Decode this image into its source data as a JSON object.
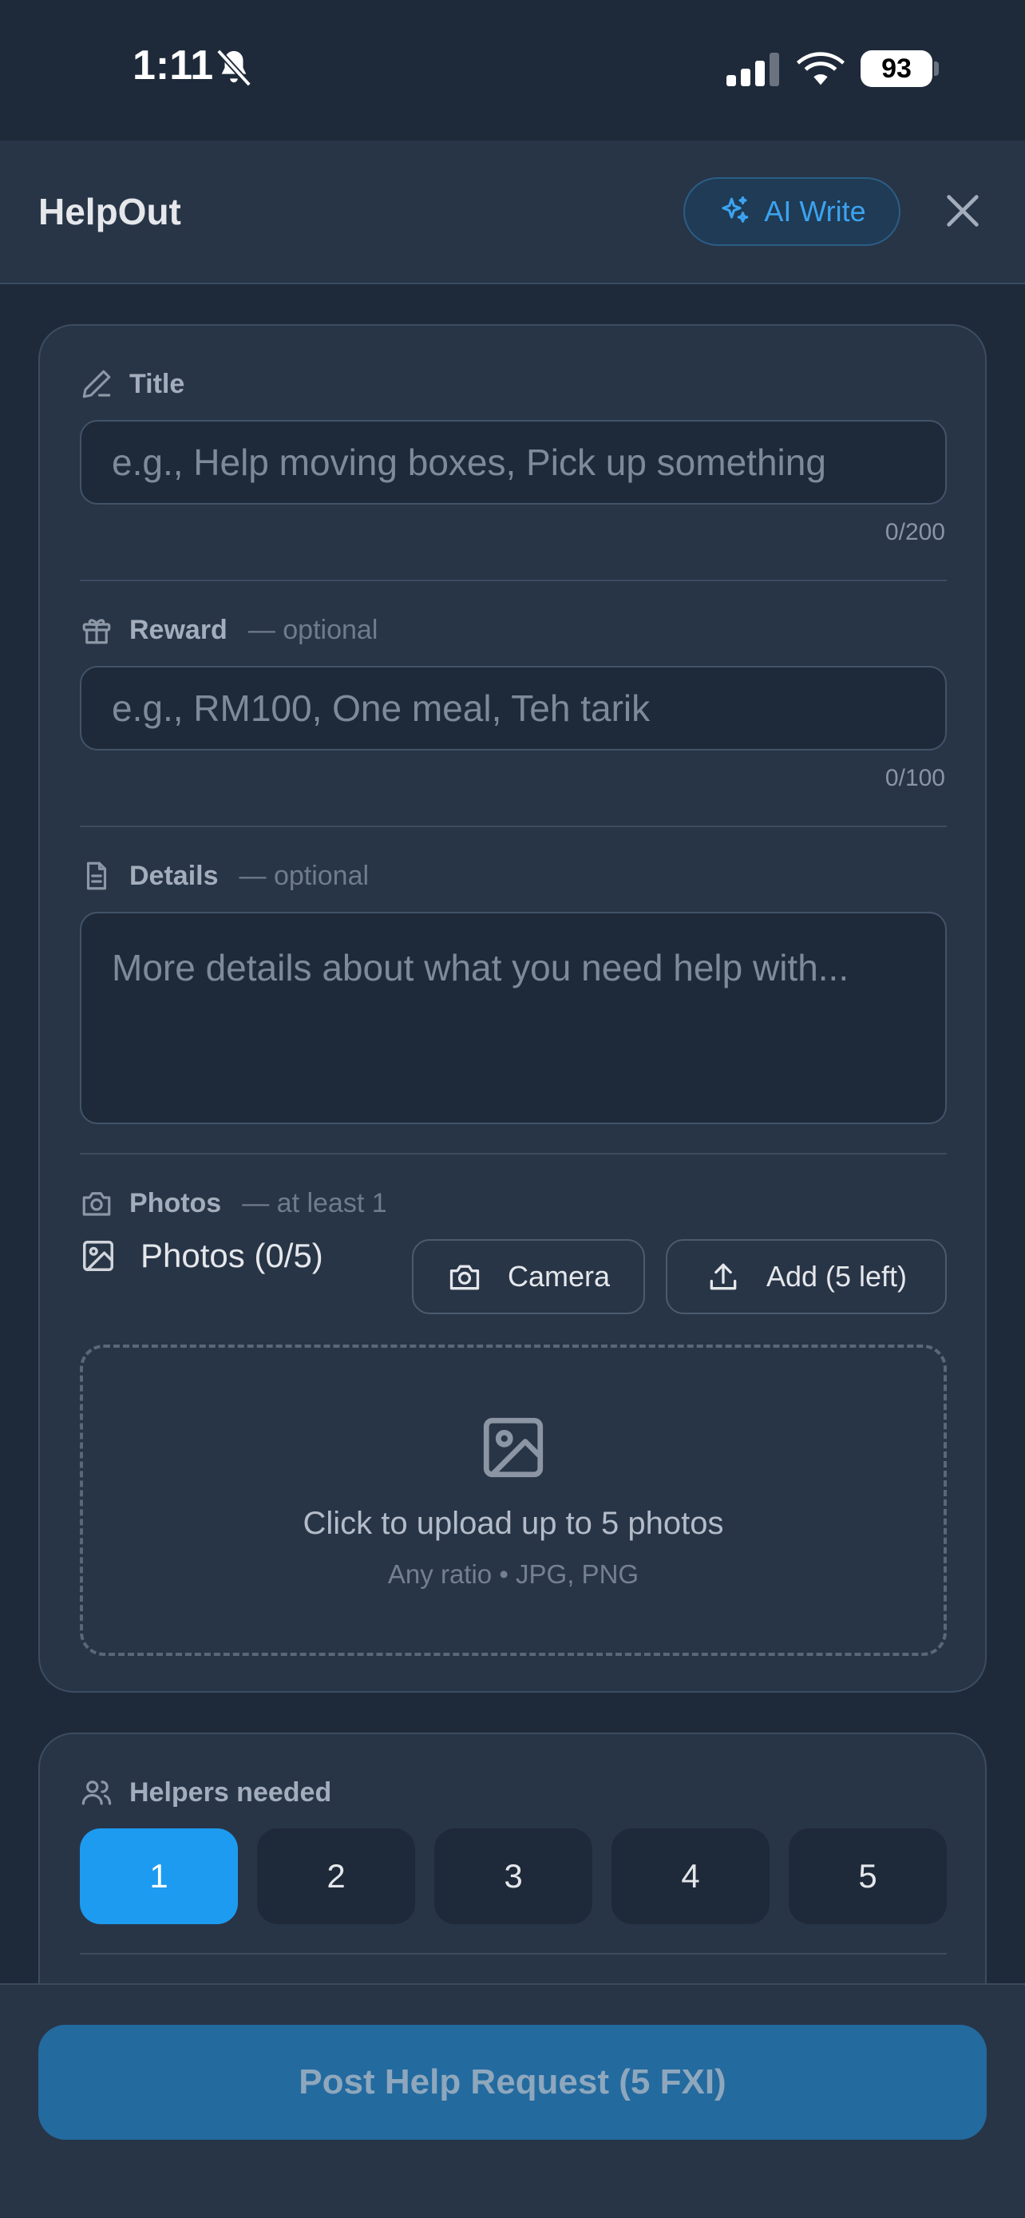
{
  "status_bar": {
    "time": "1:11",
    "battery": "93"
  },
  "header": {
    "title": "HelpOut",
    "ai_write_label": "AI Write"
  },
  "form": {
    "title_field": {
      "label": "Title",
      "placeholder": "e.g., Help moving boxes, Pick up something",
      "counter": "0/200"
    },
    "reward_field": {
      "label": "Reward",
      "note": "— optional",
      "placeholder": "e.g., RM100, One meal, Teh tarik",
      "counter": "0/100"
    },
    "details_field": {
      "label": "Details",
      "note": "— optional",
      "placeholder": "More details about what you need help with..."
    },
    "photos": {
      "label": "Photos",
      "note": "— at least 1",
      "count_label": "Photos (0/5)",
      "camera_label": "Camera",
      "add_label": "Add (5 left)",
      "upload_text": "Click to upload up to 5 photos",
      "upload_subtext": "Any ratio • JPG, PNG"
    },
    "helpers": {
      "label": "Helpers needed",
      "options": [
        "1",
        "2",
        "3",
        "4",
        "5"
      ],
      "selected": "1"
    }
  },
  "footer": {
    "submit_label": "Post Help Request (5 FXI)"
  },
  "colors": {
    "accent": "#1d9bf0",
    "background": "#1e2a3a",
    "card": "#283547"
  },
  "icons": [
    "bell-off-icon",
    "signal-icon",
    "wifi-icon",
    "sparkles-icon",
    "close-icon",
    "pencil-icon",
    "gift-icon",
    "document-icon",
    "camera-icon",
    "image-icon",
    "upload-icon",
    "users-icon"
  ]
}
